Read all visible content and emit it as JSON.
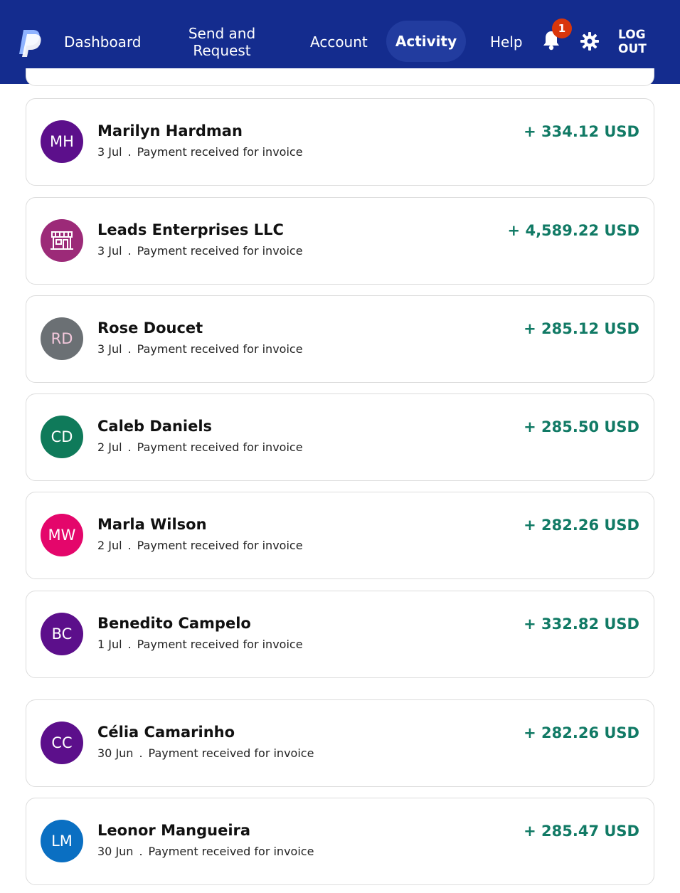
{
  "nav": {
    "dashboard": "Dashboard",
    "send_request": "Send and Request",
    "account": "Account",
    "activity": "Activity",
    "help": "Help",
    "notification_count": "1",
    "logout": "LOG OUT",
    "bg_color": "#142c8e",
    "active_color": "#223c9f",
    "icons": [
      "paypal-logo",
      "bell-icon",
      "gear-icon"
    ]
  },
  "transactions": [
    {
      "initials": "MH",
      "name": "Marilyn Hardman",
      "date": "3 Jul",
      "description": "Payment received for invoice",
      "amount": "+ 334.12 USD",
      "avatar_color": "#5c0f8b"
    },
    {
      "initials": "",
      "icon": "store-icon",
      "name": "Leads Enterprises LLC",
      "date": "3 Jul",
      "description": "Payment received for invoice",
      "amount": "+ 4,589.22 USD",
      "avatar_color": "#9c2a78"
    },
    {
      "initials": "RD",
      "name": "Rose Doucet",
      "date": "3 Jul",
      "description": "Payment received for invoice",
      "amount": "+ 285.12 USD",
      "avatar_color": "#6b7074"
    },
    {
      "initials": "CD",
      "name": "Caleb Daniels",
      "date": "2 Jul",
      "description": "Payment received for invoice",
      "amount": "+ 285.50 USD",
      "avatar_color": "#0f7a5a"
    },
    {
      "initials": "MW",
      "name": "Marla Wilson",
      "date": "2 Jul",
      "description": "Payment received for invoice",
      "amount": "+ 282.26 USD",
      "avatar_color": "#e4066b"
    },
    {
      "initials": "BC",
      "name": "Benedito Campelo",
      "date": "1 Jul",
      "description": "Payment received for invoice",
      "amount": "+ 332.82 USD",
      "avatar_color": "#5c0f8b"
    },
    {
      "initials": "CC",
      "name": "Célia Camarinho",
      "date": "30 Jun",
      "description": "Payment received for invoice",
      "amount": "+ 282.26 USD",
      "avatar_color": "#5c0f8b"
    },
    {
      "initials": "LM",
      "name": "Leonor Mangueira",
      "date": "30 Jun",
      "description": "Payment received for invoice",
      "amount": "+ 285.47 USD",
      "avatar_color": "#0a6fc2"
    }
  ],
  "amount_color": "#117a65"
}
